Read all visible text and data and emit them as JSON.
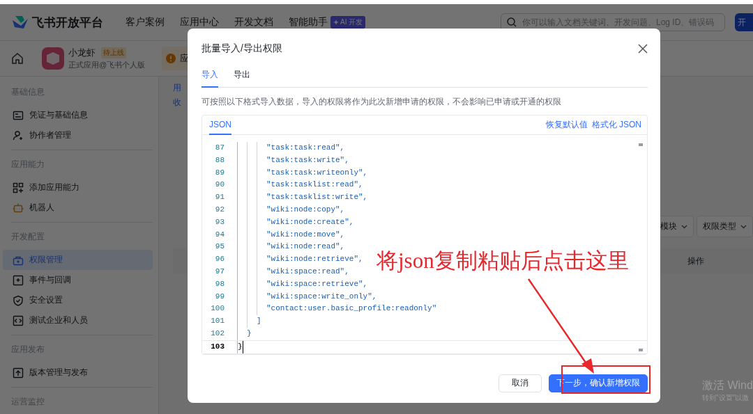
{
  "header": {
    "brand": "飞书开放平台",
    "nav": [
      "客户案例",
      "应用中心",
      "开发文档",
      "智能助手"
    ],
    "ai_badge": "AI 开发",
    "search": {
      "placeholder": "你可以输入文档关键词、开发问题、Log ID、错误码"
    },
    "cta": "开"
  },
  "app_bar": {
    "app_name": "小龙虾",
    "status_badge": "待上线",
    "subtitle": "正式应用@飞书个人版",
    "notice": "应"
  },
  "sidebar": {
    "groups": [
      {
        "title": "基础信息",
        "items": [
          {
            "label": "凭证与基础信息",
            "selected": false
          },
          {
            "label": "协作者管理",
            "selected": false
          }
        ]
      },
      {
        "title": "应用能力",
        "items": [
          {
            "label": "添加应用能力",
            "selected": false
          },
          {
            "label": "机器人",
            "selected": false
          }
        ]
      },
      {
        "title": "开发配置",
        "items": [
          {
            "label": "权限管理",
            "selected": true
          },
          {
            "label": "事件与回调",
            "selected": false
          },
          {
            "label": "安全设置",
            "selected": false
          },
          {
            "label": "测试企业和人员",
            "selected": false
          }
        ]
      },
      {
        "title": "应用发布",
        "items": [
          {
            "label": "版本管理与发布",
            "selected": false
          }
        ]
      },
      {
        "title": "运营监控"
      }
    ]
  },
  "background": {
    "fragments": [
      "用",
      "收"
    ],
    "filters": [
      "模块",
      "权限类型"
    ],
    "table_header": "操作"
  },
  "dialog": {
    "title": "批量导入/导出权限",
    "tabs": [
      {
        "label": "导入",
        "selected": true
      },
      {
        "label": "导出",
        "selected": false
      }
    ],
    "description": "可按照以下格式导入数据，导入的权限将作为此次新增申请的权限，不会影响已申请或开通的权限",
    "editor": {
      "tab": "JSON",
      "actions": [
        "恢复默认值",
        "格式化 JSON"
      ],
      "lines": [
        {
          "number": "87",
          "text": "      \"task:task:read\",",
          "current": false
        },
        {
          "number": "88",
          "text": "      \"task:task:write\",",
          "current": false
        },
        {
          "number": "89",
          "text": "      \"task:task:writeonly\",",
          "current": false
        },
        {
          "number": "90",
          "text": "      \"task:tasklist:read\",",
          "current": false
        },
        {
          "number": "91",
          "text": "      \"task:tasklist:write\",",
          "current": false
        },
        {
          "number": "92",
          "text": "      \"wiki:node:copy\",",
          "current": false
        },
        {
          "number": "93",
          "text": "      \"wiki:node:create\",",
          "current": false
        },
        {
          "number": "94",
          "text": "      \"wiki:node:move\",",
          "current": false
        },
        {
          "number": "95",
          "text": "      \"wiki:node:read\",",
          "current": false
        },
        {
          "number": "96",
          "text": "      \"wiki:node:retrieve\",",
          "current": false
        },
        {
          "number": "97",
          "text": "      \"wiki:space:read\",",
          "current": false
        },
        {
          "number": "98",
          "text": "      \"wiki:space:retrieve\",",
          "current": false
        },
        {
          "number": "99",
          "text": "      \"wiki:space:write_only\",",
          "current": false
        },
        {
          "number": "100",
          "text": "      \"contact:user.basic_profile:readonly\"",
          "current": false
        },
        {
          "number": "101",
          "text": "    ]",
          "current": false
        },
        {
          "number": "102",
          "text": "  }",
          "current": false
        },
        {
          "number": "103",
          "text": "}",
          "current": true
        }
      ]
    },
    "buttons": [
      {
        "label": "取消",
        "kind": "secondary"
      },
      {
        "label": "下一步，确认新增权限",
        "kind": "primary"
      }
    ]
  },
  "annotation": {
    "text": "将json复制粘贴后点击这里"
  },
  "os_notice": {
    "title": "激活 Wind",
    "subtitle": "转到\"设置\"以激"
  }
}
